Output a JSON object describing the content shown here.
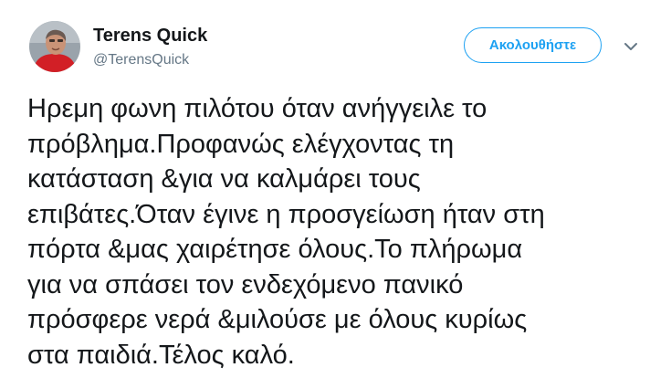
{
  "author": {
    "display_name": "Terens Quick",
    "handle": "@TerensQuick",
    "avatar_icon": "profile-photo"
  },
  "actions": {
    "follow_label": "Ακολουθήστε",
    "more_icon": "chevron-down-icon"
  },
  "tweet": {
    "text": "Ηρεμη φωνη πιλότου όταν ανήγγειλε το\nπρόβλημα.Προφανώς  ελέγχοντας τη\nκατάσταση &για να καλμάρει τους\nεπιβάτες.Όταν έγινε η προσγείωση ήταν στη\nπόρτα &μας χαιρέτησε όλους.Το πλήρωμα\nγια να σπάσει τον ενδεχόμενο πανικό\nπρόσφερε νερά &μιλούσε με όλους κυρίως\nστα παιδιά.Τέλος καλό."
  },
  "colors": {
    "accent": "#1da1f2",
    "text": "#14171a",
    "secondary_text": "#657786"
  }
}
